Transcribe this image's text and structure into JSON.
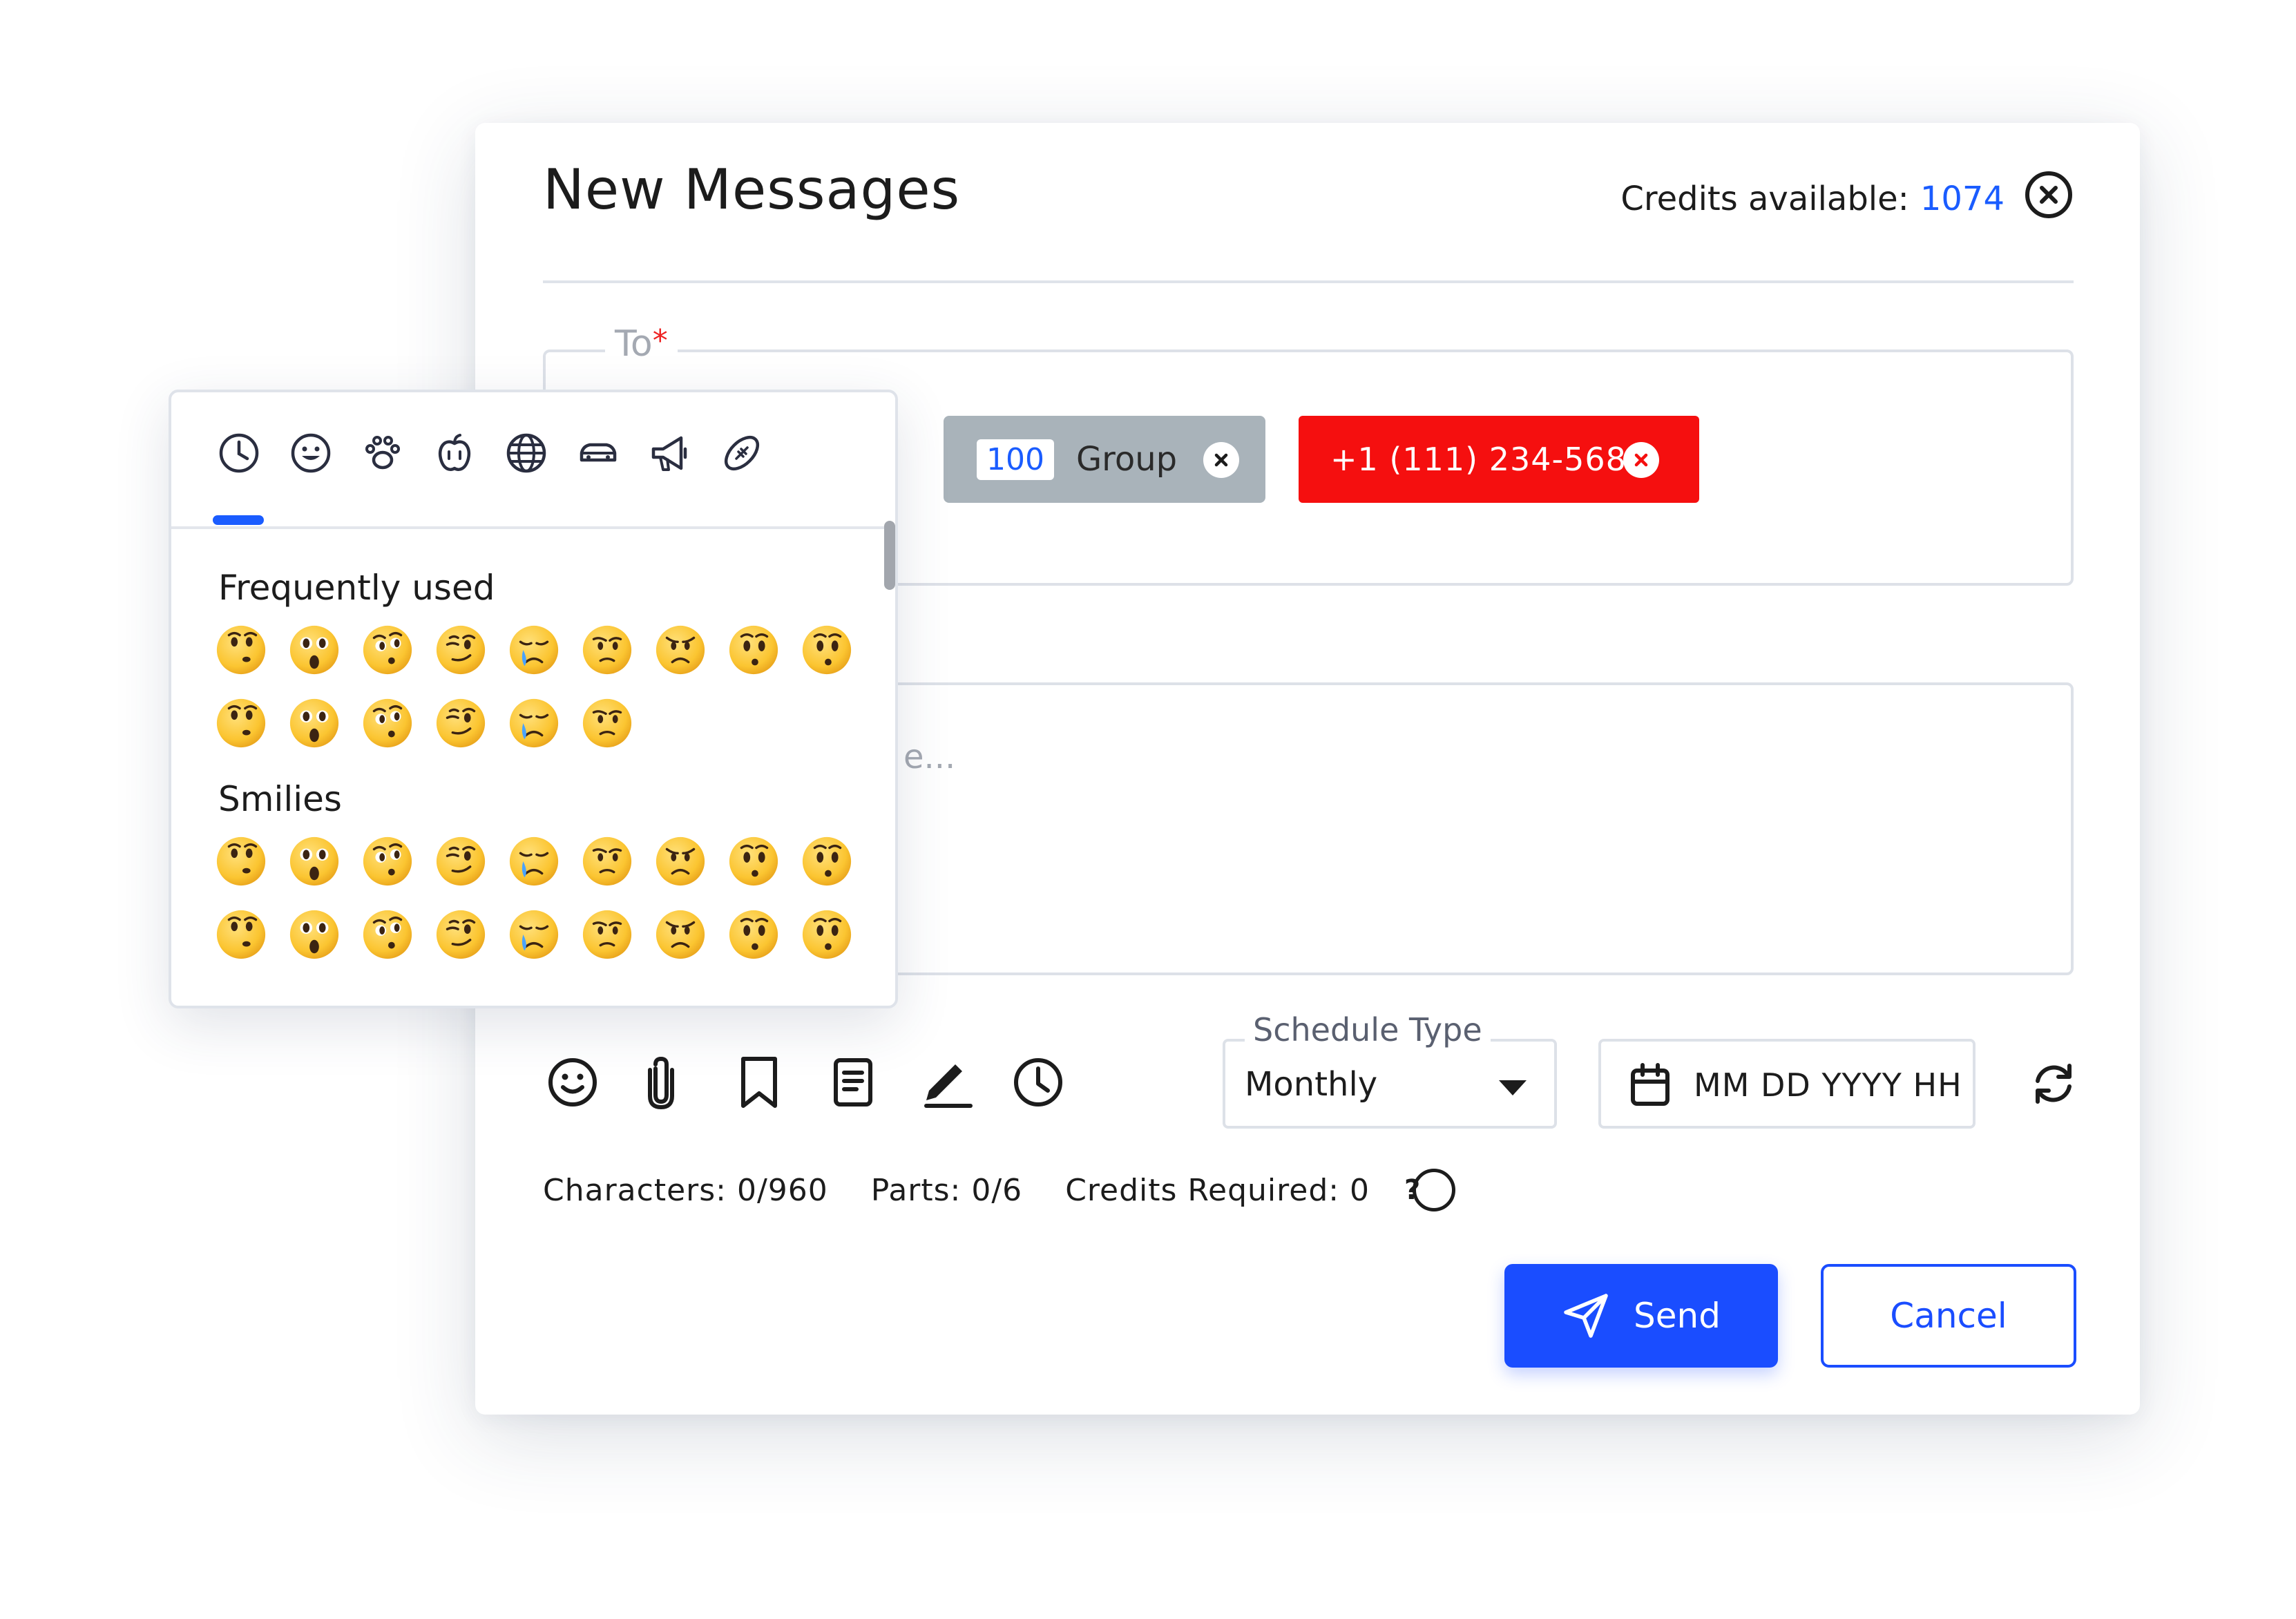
{
  "header": {
    "title": "New Messages",
    "credits_label": "Credits available:",
    "credits_value": "1074"
  },
  "to_field": {
    "label": "To",
    "required_mark": "*",
    "chips": [
      {
        "count": "100",
        "label": "Group",
        "color": "#a9b3ba"
      },
      {
        "label": "+1 (111) 234-5688",
        "color": "#f50f0f"
      }
    ]
  },
  "message": {
    "placeholder_fragment": "e..."
  },
  "toolbar": {
    "icons": [
      "emoji-icon",
      "attachment-icon",
      "bookmark-icon",
      "template-icon",
      "signature-icon",
      "clock-icon"
    ]
  },
  "schedule": {
    "label": "Schedule Type",
    "value": "Monthly",
    "date_placeholder": "MM DD YYYY HH"
  },
  "stats": {
    "characters": "Characters: 0/960",
    "parts": "Parts: 0/6",
    "credits_required": "Credits Required: 0",
    "help_symbol": "?"
  },
  "actions": {
    "send_label": "Send",
    "cancel_label": "Cancel",
    "accent_color": "#1a4dff"
  },
  "emoji_picker": {
    "categories": [
      "recent-icon",
      "smiley-icon",
      "paw-icon",
      "apple-icon",
      "globe-icon",
      "car-icon",
      "megaphone-icon",
      "football-icon"
    ],
    "active_category": "recent-icon",
    "sections": [
      {
        "title": "Frequently used",
        "rows": [
          [
            "eyes-up",
            "shocked",
            "surprised-eyes",
            "wink",
            "crying",
            "worried",
            "frown",
            "hushed",
            "hushed"
          ],
          [
            "eyes-up",
            "shocked",
            "surprised-eyes",
            "wink",
            "crying",
            "worried"
          ]
        ]
      },
      {
        "title": "Smilies",
        "rows": [
          [
            "eyes-up",
            "shocked",
            "surprised-eyes",
            "wink",
            "crying",
            "worried",
            "frown",
            "hushed",
            "hushed"
          ],
          [
            "eyes-up",
            "shocked",
            "surprised-eyes",
            "wink",
            "crying",
            "worried",
            "frown",
            "hushed",
            "hushed"
          ]
        ]
      }
    ]
  }
}
